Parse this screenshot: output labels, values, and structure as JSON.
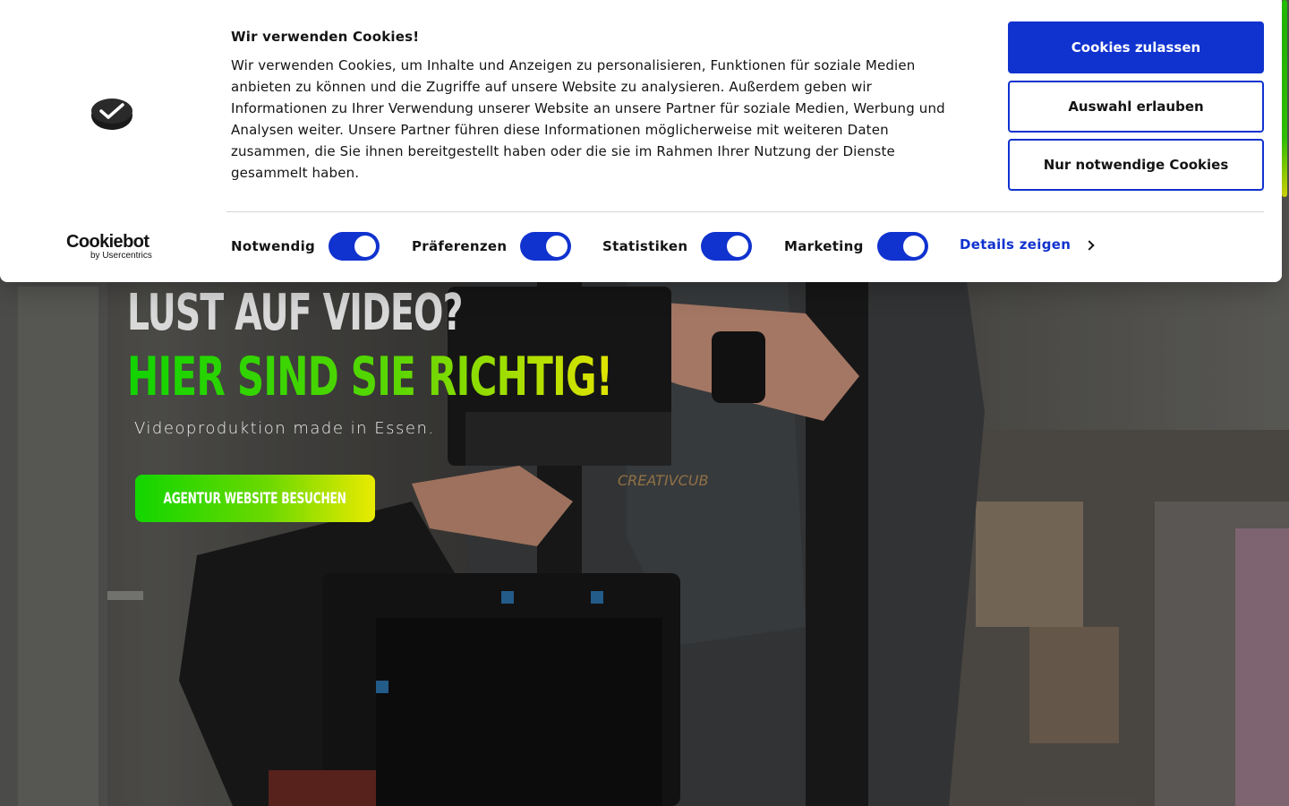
{
  "cookie_banner": {
    "title": "Wir verwenden Cookies!",
    "text": "Wir verwenden Cookies, um Inhalte und Anzeigen zu personalisieren, Funktionen für soziale Medien anbieten zu können und die Zugriffe auf unsere Website zu analysieren. Außerdem geben wir Informationen zu Ihrer Verwendung unserer Website an unsere Partner für soziale Medien, Werbung und Analysen weiter. Unsere Partner führen diese Informationen möglicherweise mit weiteren Daten zusammen, die Sie ihnen bereitgestellt haben oder die sie im Rahmen Ihrer Nutzung der Dienste gesammelt haben.",
    "buttons": {
      "allow_all": "Cookies zulassen",
      "allow_selection": "Auswahl erlauben",
      "necessary_only": "Nur notwendige Cookies"
    },
    "toggles": [
      {
        "label": "Notwendig",
        "checked": true
      },
      {
        "label": "Präferenzen",
        "checked": true
      },
      {
        "label": "Statistiken",
        "checked": true
      },
      {
        "label": "Marketing",
        "checked": true
      }
    ],
    "details_link": "Details zeigen",
    "brand": {
      "name": "Cookiebot",
      "byline": "by Usercentrics"
    },
    "icons": {
      "logo": "cookie-consent-logo-icon",
      "chevron": "chevron-right-icon"
    }
  },
  "hero": {
    "headline_1": "Lust auf Video?",
    "headline_2": "Hier sind Sie richtig!",
    "subline": "Videoproduktion made in Essen.",
    "cta_label": "Agentur Website besuchen"
  },
  "colors": {
    "primary_blue": "#1032cf",
    "accent_green": "#12d600",
    "accent_yellow": "#eaea00",
    "text_dark": "#141414",
    "banner_bg": "#ffffff"
  }
}
